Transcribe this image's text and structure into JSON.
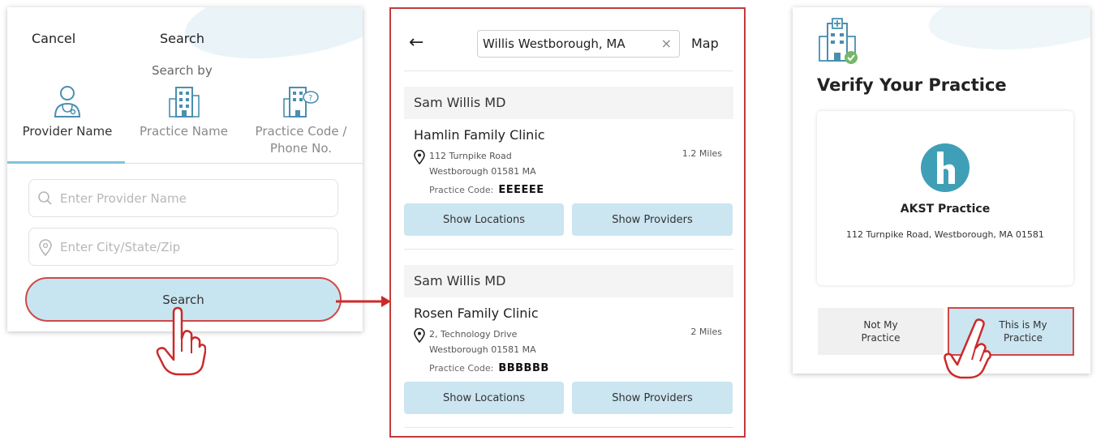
{
  "search_panel": {
    "cancel_label": "Cancel",
    "title": "Search",
    "search_by_label": "Search by",
    "tabs": [
      {
        "label": "Provider Name",
        "icon": "doctor-icon",
        "active": true
      },
      {
        "label": "Practice Name",
        "icon": "building-icon",
        "active": false
      },
      {
        "label": "Practice Code / Phone No.",
        "icon": "building-phone-icon",
        "active": false
      }
    ],
    "provider_placeholder": "Enter Provider Name",
    "location_placeholder": "Enter City/State/Zip",
    "search_button_label": "Search"
  },
  "results_panel": {
    "search_value": "Willis Westborough, MA",
    "map_label": "Map",
    "clear_icon": "×",
    "back_icon": "←",
    "results": [
      {
        "provider": "Sam Willis MD",
        "clinic": "Hamlin Family Clinic",
        "address_line1": "112 Turnpike Road",
        "address_line2": "Westborough 01581 MA",
        "distance": "1.2 Miles",
        "code_label": "Practice Code:",
        "code": "EEEEEE",
        "show_locations_label": "Show Locations",
        "show_providers_label": "Show Providers"
      },
      {
        "provider": "Sam Willis MD",
        "clinic": "Rosen Family Clinic",
        "address_line1": "2, Technology Drive",
        "address_line2": "Westborough 01581 MA",
        "distance": "2 Miles",
        "code_label": "Practice Code:",
        "code": "BBBBBB",
        "show_locations_label": "Show Locations",
        "show_providers_label": "Show Providers"
      }
    ]
  },
  "verify_panel": {
    "title": "Verify Your Practice",
    "practice_name": "AKST Practice",
    "practice_address": "112 Turnpike Road, Westborough, MA 01581",
    "not_my_practice_line1": "Not My",
    "not_my_practice_line2": "Practice",
    "this_is_my_practice_line1": "This is My",
    "this_is_my_practice_line2": "Practice"
  },
  "colors": {
    "accent_blue": "#cbe5f1",
    "highlight_red": "#d04848",
    "logo_teal": "#3f9fb7"
  }
}
